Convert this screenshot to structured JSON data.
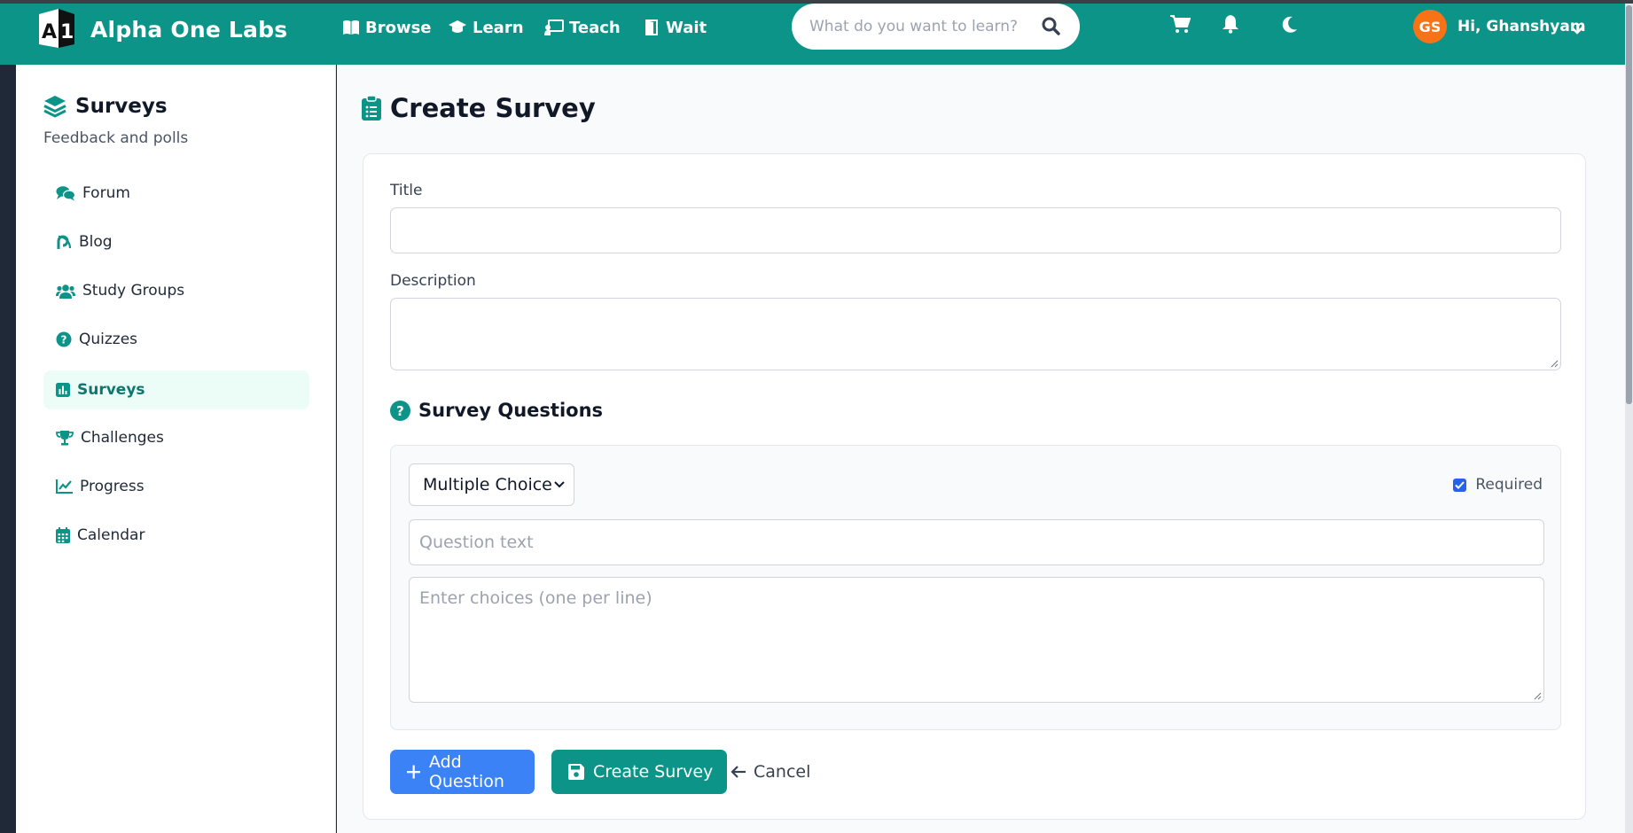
{
  "brand": {
    "logo_text": "A1",
    "name": "Alpha One Labs"
  },
  "nav": {
    "links": [
      {
        "label": "Browse",
        "icon": "book-icon"
      },
      {
        "label": "Learn",
        "icon": "graduation-cap-icon"
      },
      {
        "label": "Teach",
        "icon": "chalkboard-teacher-icon"
      },
      {
        "label": "Wait",
        "icon": "door-icon"
      }
    ],
    "search_placeholder": "What do you want to learn?",
    "avatar_initials": "GS",
    "greeting": "Hi, Ghanshyam"
  },
  "sidebar": {
    "title": "Surveys",
    "subtitle": "Feedback and polls",
    "items": [
      {
        "label": "Forum",
        "icon": "comments-icon"
      },
      {
        "label": "Blog",
        "icon": "blog-icon"
      },
      {
        "label": "Study Groups",
        "icon": "users-icon"
      },
      {
        "label": "Quizzes",
        "icon": "question-circle-icon"
      },
      {
        "label": "Surveys",
        "icon": "poll-icon",
        "active": true
      },
      {
        "label": "Challenges",
        "icon": "trophy-icon"
      },
      {
        "label": "Progress",
        "icon": "chart-line-icon"
      },
      {
        "label": "Calendar",
        "icon": "calendar-icon"
      }
    ]
  },
  "main": {
    "title": "Create Survey",
    "form": {
      "title_label": "Title",
      "title_value": "",
      "description_label": "Description",
      "description_value": "",
      "questions_heading": "Survey Questions",
      "question": {
        "type": "Multiple Choice",
        "required_label": "Required",
        "required_checked": true,
        "text_placeholder": "Question text",
        "choices_placeholder": "Enter choices (one per line)"
      },
      "add_question_label": "Add Question",
      "create_label": "Create Survey",
      "cancel_label": "Cancel"
    }
  },
  "colors": {
    "primary": "#0d9488",
    "blue": "#3b82f6",
    "avatar": "#f97316",
    "active_bg": "#ecfdf8"
  }
}
